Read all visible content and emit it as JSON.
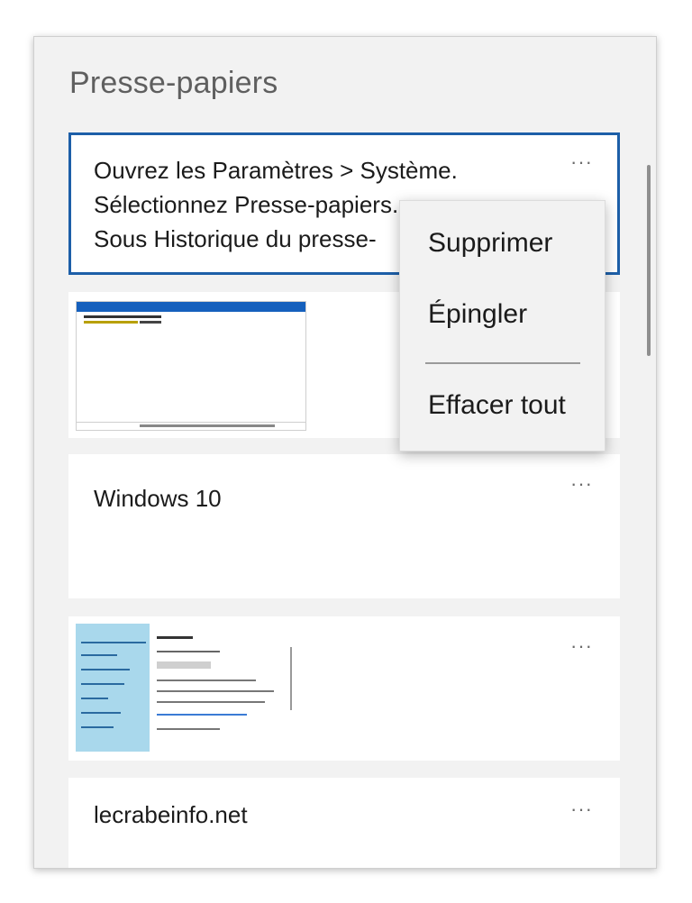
{
  "panel": {
    "title": "Presse-papiers"
  },
  "items": [
    {
      "lines": [
        "Ouvrez les Paramètres > Système.",
        "Sélectionnez Presse-papiers.",
        "Sous Historique du presse-"
      ],
      "more": "···"
    },
    {
      "type": "image",
      "more": "···"
    },
    {
      "text": "Windows 10",
      "more": "···"
    },
    {
      "type": "image",
      "more": "···"
    },
    {
      "text": "lecrabeinfo.net",
      "more": "···"
    }
  ],
  "context_menu": {
    "delete": "Supprimer",
    "pin": "Épingler",
    "clear_all": "Effacer tout"
  },
  "colors": {
    "accent": "#1d5fa8",
    "panel_bg": "#f2f2f2",
    "card_bg": "#ffffff"
  }
}
